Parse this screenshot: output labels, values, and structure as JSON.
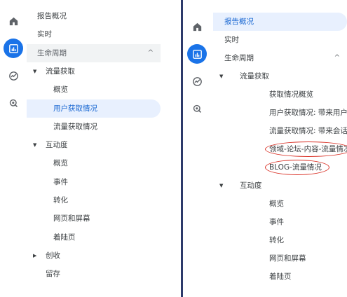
{
  "left": {
    "rail": [
      {
        "icon": "home-icon",
        "active": false
      },
      {
        "icon": "reports-icon",
        "active": true
      },
      {
        "icon": "explore-icon",
        "active": false
      },
      {
        "icon": "advertising-icon",
        "active": false
      }
    ],
    "items": [
      {
        "label": "报告概况",
        "kind": "top",
        "indent": 0
      },
      {
        "label": "实时",
        "kind": "top",
        "indent": 0
      },
      {
        "label": "生命周期",
        "kind": "group",
        "indent": 0,
        "chevron": "^"
      },
      {
        "label": "流量获取",
        "kind": "section",
        "indent": 1,
        "arrow": "▼"
      },
      {
        "label": "概览",
        "kind": "leaf",
        "indent": 2
      },
      {
        "label": "用户获取情况",
        "kind": "selected",
        "indent": 2
      },
      {
        "label": "流量获取情况",
        "kind": "leaf",
        "indent": 2
      },
      {
        "label": "互动度",
        "kind": "section",
        "indent": 1,
        "arrow": "▼"
      },
      {
        "label": "概览",
        "kind": "leaf",
        "indent": 2
      },
      {
        "label": "事件",
        "kind": "leaf",
        "indent": 2
      },
      {
        "label": "转化",
        "kind": "leaf",
        "indent": 2
      },
      {
        "label": "网页和屏幕",
        "kind": "leaf",
        "indent": 2
      },
      {
        "label": "着陆页",
        "kind": "leaf",
        "indent": 2
      },
      {
        "label": "创收",
        "kind": "section",
        "indent": 1,
        "arrow": "▶"
      },
      {
        "label": "留存",
        "kind": "section",
        "indent": 1
      }
    ]
  },
  "right": {
    "rail": [
      {
        "icon": "home-icon",
        "active": false
      },
      {
        "icon": "reports-icon",
        "active": true
      },
      {
        "icon": "explore-icon",
        "active": false
      },
      {
        "icon": "advertising-icon",
        "active": false
      }
    ],
    "items": [
      {
        "label": "报告概况",
        "kind": "selected",
        "indent": 0
      },
      {
        "label": "实时",
        "kind": "top",
        "indent": 0
      },
      {
        "label": "生命周期",
        "kind": "top",
        "indent": 0,
        "chevron": "^"
      },
      {
        "label": "流量获取",
        "kind": "section",
        "indent": 1,
        "arrow": "▼"
      },
      {
        "label": "获取情况概览",
        "kind": "leaf",
        "indent": 2
      },
      {
        "label": "用户获取情况: 带来用户首次...",
        "kind": "leaf",
        "indent": 2
      },
      {
        "label": "流量获取情况: 带来会话的默...",
        "kind": "leaf",
        "indent": 2
      },
      {
        "label": "领域-论坛-内容-流量情况",
        "kind": "leaf",
        "indent": 2,
        "circled": true
      },
      {
        "label": "BLOG-流量情况",
        "kind": "leaf",
        "indent": 2,
        "circled": true
      },
      {
        "label": "互动度",
        "kind": "section",
        "indent": 1,
        "arrow": "▼"
      },
      {
        "label": "概览",
        "kind": "leaf",
        "indent": 2
      },
      {
        "label": "事件",
        "kind": "leaf",
        "indent": 2
      },
      {
        "label": "转化",
        "kind": "leaf",
        "indent": 2
      },
      {
        "label": "网页和屏幕",
        "kind": "leaf",
        "indent": 2
      },
      {
        "label": "着陆页",
        "kind": "leaf",
        "indent": 2
      }
    ]
  },
  "colors": {
    "accent": "#1a73e8",
    "selected_bg": "#e8f0fe",
    "group_bg": "#f1f3f4",
    "annotation": "#d93025",
    "divider": "#2d3a6b"
  }
}
